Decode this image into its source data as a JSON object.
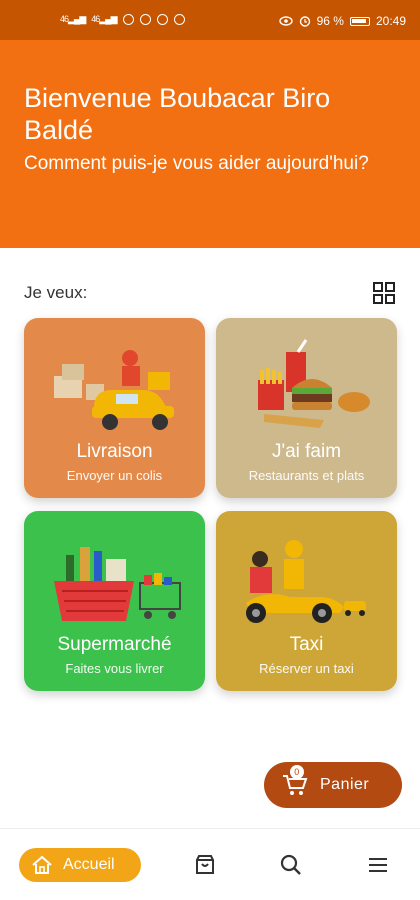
{
  "status_bar": {
    "network_left": "46",
    "network_right": "46",
    "battery_percent": "96 %",
    "time": "20:49"
  },
  "hero": {
    "title": "Bienvenue Boubacar Biro Baldé",
    "subtitle": "Comment puis-je vous aider aujourd'hui?"
  },
  "section": {
    "label": "Je veux:",
    "view_toggle_icon": "grid-icon"
  },
  "cards": [
    {
      "title": "Livraison",
      "subtitle": "Envoyer un colis",
      "color": "#e38a4a",
      "icon": "delivery-scooter-illustration"
    },
    {
      "title": "J'ai faim",
      "subtitle": "Restaurants et plats",
      "color": "#cdb98c",
      "icon": "fast-food-illustration"
    },
    {
      "title": "Supermarché",
      "subtitle": "Faites vous livrer",
      "color": "#3cc24c",
      "icon": "grocery-basket-illustration"
    },
    {
      "title": "Taxi",
      "subtitle": "Réserver un taxi",
      "color": "#cea638",
      "icon": "moto-taxi-illustration"
    }
  ],
  "cart_button": {
    "label": "Panier",
    "count": "0",
    "color": "#b24a12"
  },
  "bottom_nav": {
    "home_label": "Accueil",
    "home_color": "#f2a516",
    "items": [
      "orders-icon",
      "search-icon",
      "menu-icon"
    ]
  },
  "colors": {
    "accent": "#f27012",
    "status_bar": "#c55500"
  }
}
